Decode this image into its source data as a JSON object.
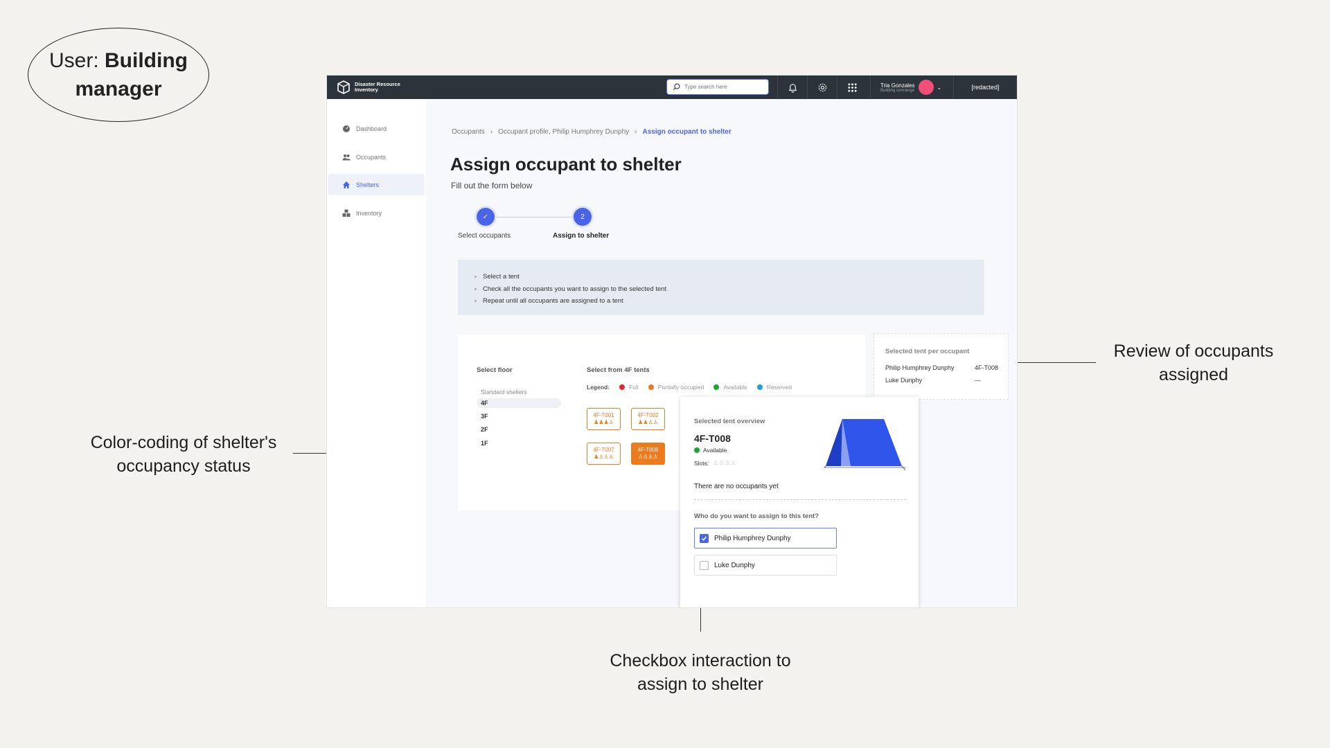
{
  "annotations": {
    "user_prefix": "User: ",
    "user_role": "Building manager",
    "review": "Review of occupants assigned",
    "color_coding": "Color-coding of shelter's occupancy status",
    "checkbox": "Checkbox interaction to assign to shelter"
  },
  "topbar": {
    "logo_text": "Disaster Resource Inventory",
    "search_placeholder": "Type search here",
    "user_name": "Tria Gonzales",
    "user_role": "Building concierge",
    "redacted": "[redacted]"
  },
  "sidebar": {
    "items": [
      {
        "label": "Dashboard",
        "icon": "dashboard-icon"
      },
      {
        "label": "Occupants",
        "icon": "users-icon"
      },
      {
        "label": "Shelters",
        "icon": "home-icon",
        "active": true
      },
      {
        "label": "Inventory",
        "icon": "inventory-icon"
      }
    ]
  },
  "breadcrumb": [
    "Occupants",
    "Occupant profile, Philip Humphrey Dunphy",
    "Assign occupant to shelter"
  ],
  "page": {
    "title": "Assign occupant to shelter",
    "subtitle": "Fill out the form below"
  },
  "stepper": {
    "steps": [
      {
        "label": "Select occupants",
        "marker": "✓"
      },
      {
        "label": "Assign to shelter",
        "marker": "2"
      }
    ]
  },
  "instructions": [
    "Select a tent",
    "Check all the occupants you want to assign to the selected tent",
    "Repeat until all occupants are assigned to a tent"
  ],
  "floors": {
    "label": "Select floor",
    "category": "Standard shelters",
    "items": [
      "4F",
      "3F",
      "2F",
      "1F"
    ],
    "selected": "4F"
  },
  "tents": {
    "label": "Select from 4F tents",
    "legend_title": "Legend:",
    "legend": [
      {
        "label": "Full",
        "color": "#e5262f"
      },
      {
        "label": "Partially occupied",
        "color": "#ec7b1e"
      },
      {
        "label": "Available",
        "color": "#1fa33b"
      },
      {
        "label": "Reserved",
        "color": "#1f9fd0"
      }
    ],
    "items": [
      {
        "id": "4F-T001",
        "people": "♟♟♟♙"
      },
      {
        "id": "4F-T002",
        "people": "♟♟♙♙"
      },
      {
        "id": "4F-T007",
        "people": "♟♙♙♙"
      },
      {
        "id": "4F-T008",
        "people": "♙♙♙♙",
        "selected": true
      }
    ]
  },
  "review": {
    "title": "Selected tent per occupant",
    "rows": [
      {
        "name": "Philip Humphrey Dunphy",
        "tent": "4F-T008"
      },
      {
        "name": "Luke Dunphy",
        "tent": "—"
      }
    ]
  },
  "overview": {
    "label": "Selected tent overview",
    "tent_id": "4F-T008",
    "status": "Available",
    "status_color": "#1fa33b",
    "slots_label": "Slots:",
    "slots": "♙♙♙♙",
    "empty_text": "There are no occupants yet",
    "question": "Who do you want to assign to this tent?",
    "occupants": [
      {
        "name": "Philip Humphrey Dunphy",
        "checked": true
      },
      {
        "name": "Luke Dunphy",
        "checked": false
      }
    ]
  }
}
